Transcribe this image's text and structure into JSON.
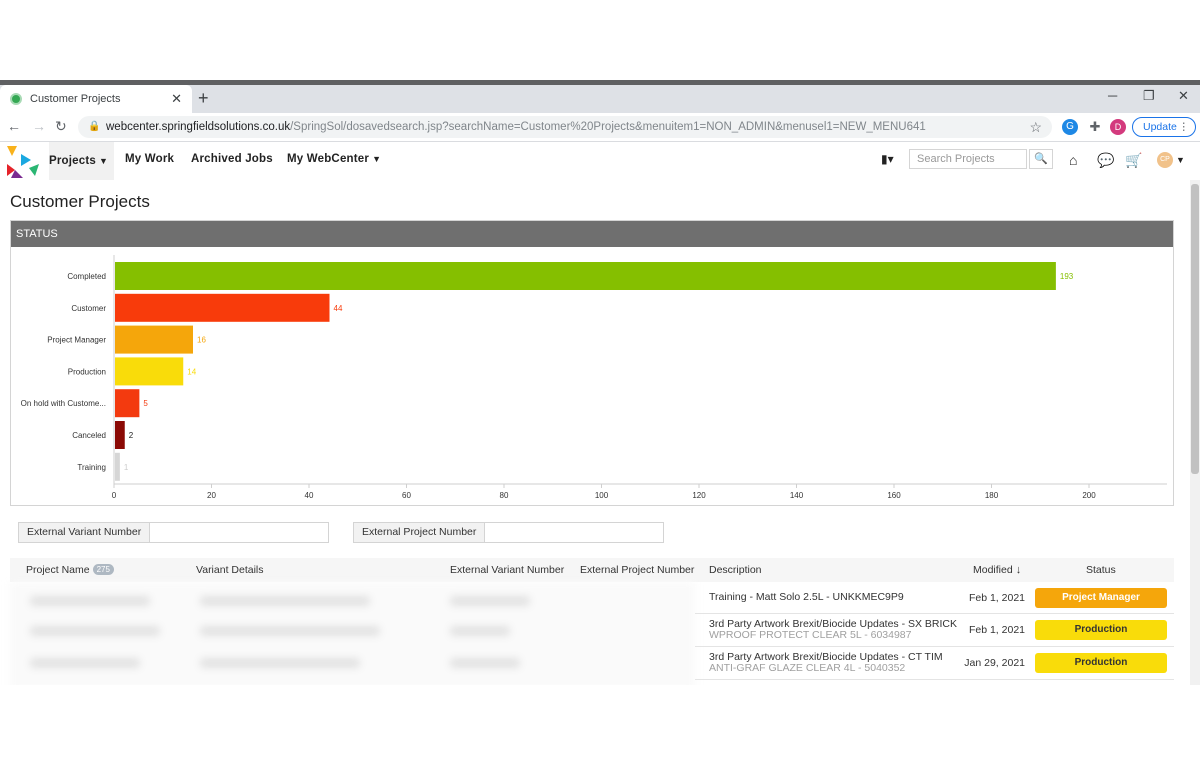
{
  "browser": {
    "tab_title": "Customer Projects",
    "url_host": "webcenter.springfieldsolutions.co.uk",
    "url_path": "/SpringSol/dosavedsearch.jsp?searchName=Customer%20Projects&menuitem1=NON_ADMIN&menusel1=NEW_MENU641",
    "profile_initial": "D",
    "update_label": "Update"
  },
  "nav": {
    "projects": "Projects",
    "my_work": "My Work",
    "archived_jobs": "Archived Jobs",
    "my_webcenter": "My WebCenter",
    "search_placeholder": "Search Projects",
    "avatar_initials": "CP"
  },
  "page": {
    "title": "Customer Projects",
    "status_header": "STATUS"
  },
  "chart_data": {
    "type": "bar",
    "orientation": "horizontal",
    "categories": [
      "Completed",
      "Customer",
      "Project Manager",
      "Production",
      "On hold with Custome...",
      "Canceled",
      "Training"
    ],
    "values": [
      193,
      44,
      16,
      14,
      5,
      2,
      1
    ],
    "colors": [
      "#85bf00",
      "#f83b0b",
      "#f5a60b",
      "#f9dc0a",
      "#f33a0f",
      "#8b0a05",
      "#d6d6d6"
    ],
    "label_colors": [
      "#85bf00",
      "#f83b0b",
      "#f5a60b",
      "#f9dc0a",
      "#f33a0f",
      "#222222",
      "#cccccc"
    ],
    "xticks": [
      0,
      20,
      40,
      60,
      80,
      100,
      120,
      140,
      160,
      180,
      200
    ],
    "xlim": [
      0,
      216
    ]
  },
  "filters": {
    "external_variant": "External Variant Number",
    "external_project": "External Project Number"
  },
  "table": {
    "headers": {
      "project_name": "Project Name",
      "project_count": "275",
      "variant_details": "Variant Details",
      "external_variant": "External Variant Number",
      "external_project": "External Project Number",
      "description": "Description",
      "modified": "Modified",
      "status": "Status"
    },
    "rows": [
      {
        "desc1": "Training - Matt Solo 2.5L - UNKKMEC9P9",
        "desc2": "",
        "modified": "Feb 1, 2021",
        "status": "Project Manager",
        "status_color": "#f5a60b",
        "status_text_color": "#ffffff"
      },
      {
        "desc1": "3rd Party Artwork Brexit/Biocide Updates - SX BRICK",
        "desc2": "WPROOF PROTECT CLEAR 5L - 6034987",
        "modified": "Feb 1, 2021",
        "status": "Production",
        "status_color": "#f9dc0a",
        "status_text_color": "#333333"
      },
      {
        "desc1": "3rd Party Artwork Brexit/Biocide Updates - CT TIM",
        "desc2": "ANTI-GRAF GLAZE CLEAR 4L - 5040352",
        "modified": "Jan 29, 2021",
        "status": "Production",
        "status_color": "#f9dc0a",
        "status_text_color": "#333333"
      },
      {
        "desc1": "3rd Party Artwork Brexit/Biocide Updates - CT TIM",
        "desc2": "",
        "modified": "",
        "status": "",
        "status_color": "#f9dc0a",
        "status_text_color": "#333333"
      }
    ]
  }
}
